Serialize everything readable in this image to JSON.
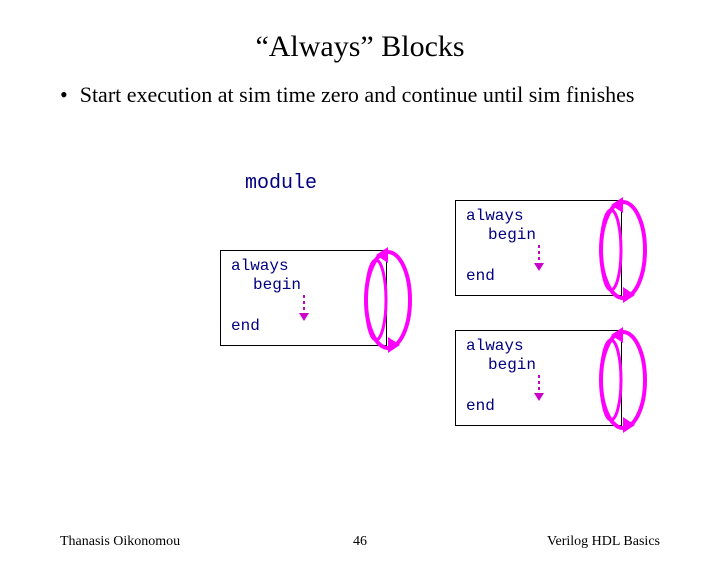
{
  "title": "“Always” Blocks",
  "bullet": "Start execution at sim time zero and continue until sim finishes",
  "module_label": "module",
  "code": {
    "always": "always",
    "begin": "begin",
    "end": "end"
  },
  "footer": {
    "author": "Thanasis Oikonomou",
    "page": "46",
    "course": "Verilog HDL Basics"
  }
}
